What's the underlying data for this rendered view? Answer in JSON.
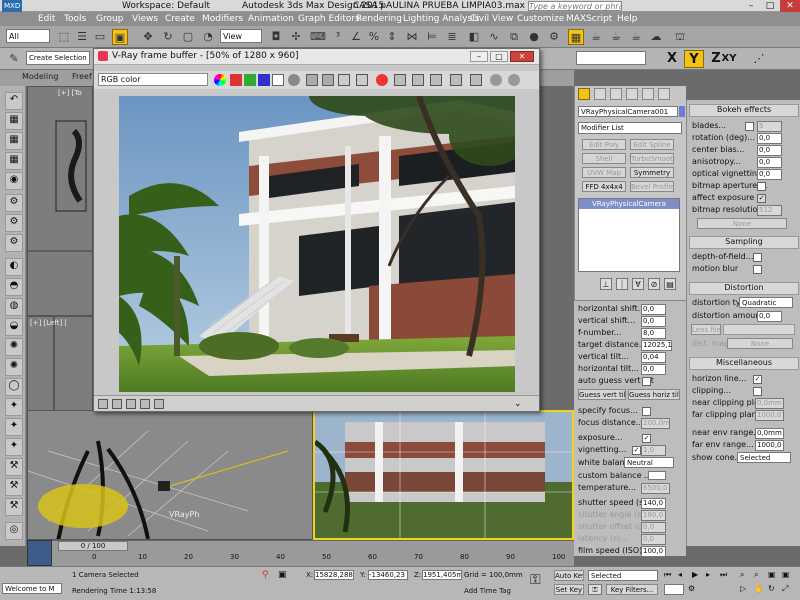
{
  "window": {
    "logo": "MXD",
    "workspace_label": "Workspace: Default",
    "app_title": "Autodesk 3ds Max Design 2015",
    "file_title": "CASA pAULINA PRUEBA LIMPIA03.max",
    "search_placeholder": "Type a keyword or phrase"
  },
  "menu": [
    "Edit",
    "Tools",
    "Group",
    "Views",
    "Create",
    "Modifiers",
    "Animation",
    "Graph Editors",
    "Rendering",
    "Lighting Analysis",
    "Civil View",
    "Customize",
    "MAXScript",
    "Help"
  ],
  "toolbar": {
    "selection_filter": "All",
    "ref_coord": "View",
    "create_selection_set": "Create Selection Se",
    "axes": [
      "X",
      "Y",
      "Z",
      "XY"
    ]
  },
  "ribbon_tabs": [
    "Modeling",
    "Freef"
  ],
  "viewports": {
    "top_left_label": "[+] [To",
    "mid_left_label": "[+] [Left] [",
    "camera_label": "VRayPh"
  },
  "vfb": {
    "title": "V-Ray frame buffer - [50% of 1280 x 960]",
    "channel": "RGB color"
  },
  "command_panel": {
    "object_name": "VRayPhysicalCamera001",
    "modifier_list": "Modifier List",
    "modifier_buttons": [
      {
        "label": "Edit Poly",
        "enabled": false
      },
      {
        "label": "Edit Spline",
        "enabled": false
      },
      {
        "label": "Shell",
        "enabled": false
      },
      {
        "label": "TurboSmooth",
        "enabled": false
      },
      {
        "label": "UVW Map",
        "enabled": false
      },
      {
        "label": "Symmetry",
        "enabled": true
      },
      {
        "label": "FFD 4x4x4",
        "enabled": true
      },
      {
        "label": "Bevel Profile",
        "enabled": false
      }
    ],
    "stack_item": "VRayPhysicalCamera",
    "params": [
      {
        "label": "horizontal shift...",
        "value": "0,0"
      },
      {
        "label": "vertical shift...",
        "value": "0,0"
      },
      {
        "label": "f-number...",
        "value": "8,0"
      },
      {
        "label": "target distance...",
        "value": "12025,1"
      },
      {
        "label": "vertical tilt...",
        "value": "0,04"
      },
      {
        "label": "horizontal tilt...",
        "value": "0,0"
      }
    ],
    "auto_guess": "auto guess vert tilt",
    "guess_vert": "Guess vert tilt",
    "guess_horiz": "Guess horiz tilt",
    "specify_focus": "specify focus...",
    "focus_distance": {
      "label": "focus distance...",
      "value": "200,0m"
    },
    "exposure": "exposure...",
    "vignetting": {
      "label": "vignetting...",
      "value": "1,0"
    },
    "white_balance": {
      "label": "white balance",
      "value": "Neutral"
    },
    "custom_balance": "custom balance ...",
    "temperature": {
      "label": "temperature...",
      "value": "6500,0"
    },
    "shutter_speed": {
      "label": "shutter speed (s^-1)",
      "value": "140,0"
    },
    "shutter_angle": {
      "label": "shutter angle (deg)",
      "value": "180,0"
    },
    "shutter_offset": {
      "label": "shutter offset (deg)",
      "value": "0,0"
    },
    "latency": {
      "label": "latency (s)...",
      "value": "0,0"
    },
    "film_speed": {
      "label": "film speed (ISO)...",
      "value": "100,0"
    }
  },
  "rollouts": {
    "bokeh": {
      "title": "Bokeh effects",
      "rows": [
        {
          "label": "blades...",
          "value": "5"
        },
        {
          "label": "rotation (deg)...",
          "value": "0,0"
        },
        {
          "label": "center bias...",
          "value": "0,0"
        },
        {
          "label": "anisotropy...",
          "value": "0,0"
        },
        {
          "label": "optical vignetting",
          "value": "0,0"
        },
        {
          "label": "bitmap aperture ...",
          "value": ""
        },
        {
          "label": "affect exposure ...",
          "value": ""
        },
        {
          "label": "bitmap resolution...",
          "value": "512"
        }
      ],
      "none_button": "None"
    },
    "sampling": {
      "title": "Sampling",
      "dof": "depth-of-field...",
      "motion_blur": "motion blur"
    },
    "distortion": {
      "title": "Distortion",
      "type_label": "distortion type",
      "type_value": "Quadratic",
      "amount_label": "distortion amount...",
      "amount_value": "0,0",
      "lens_file": "Lens file",
      "dist_map": "dist. map",
      "none": "None"
    },
    "misc": {
      "title": "Miscellaneous",
      "horizon_line": "horizon line...",
      "clipping": "clipping...",
      "near_clip": {
        "label": "near clipping plane...",
        "value": "0,0mm"
      },
      "far_clip": {
        "label": "far clipping plane...",
        "value": "1000,0"
      },
      "near_env": {
        "label": "near env range...",
        "value": "0,0mm"
      },
      "far_env": {
        "label": "far env range...",
        "value": "1000,0"
      },
      "show_cone": {
        "label": "show cone...",
        "value": "Selected"
      }
    }
  },
  "timeline": {
    "frame": "0 / 100",
    "ticks": [
      "0",
      "10",
      "20",
      "30",
      "40",
      "50",
      "60",
      "70",
      "80",
      "90",
      "100"
    ]
  },
  "status": {
    "maxscript": "Welcome to M",
    "selection": "1 Camera Selected",
    "rendering_time": "Rendering Time  1:13:58",
    "x_label": "X:",
    "x": "15828,288",
    "y_label": "Y:",
    "y": "-13460,23",
    "z_label": "Z:",
    "z": "1951,405m",
    "grid": "Grid = 100,0mm",
    "add_time_tag": "Add Time Tag",
    "auto_key": "Auto Key",
    "set_key": "Set Key",
    "key_selected": "Selected",
    "key_filters": "Key Filters..."
  },
  "colors": {
    "accent_yellow": "#f2c21a",
    "menubar": "#8f8f8f",
    "vfb_title": "#e7e7e7"
  }
}
